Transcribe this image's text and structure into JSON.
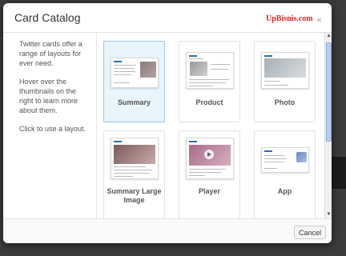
{
  "modal": {
    "title": "Card Catalog",
    "watermark": "UpBisnis.com",
    "close_glyph": "×"
  },
  "sidebar": {
    "paragraphs": [
      "Twitter cards offer a range of layouts for ever need.",
      "Hover over the thumbnails on the right to learn more about them.",
      "Click to use a layout."
    ]
  },
  "cards": [
    {
      "label": "Summary",
      "selected": true
    },
    {
      "label": "Product",
      "selected": false
    },
    {
      "label": "Photo",
      "selected": false
    },
    {
      "label": "Summary Large Image",
      "selected": false
    },
    {
      "label": "Player",
      "selected": false
    },
    {
      "label": "App",
      "selected": false
    }
  ],
  "footer": {
    "cancel_label": "Cancel"
  },
  "icons": {
    "close": "close-icon",
    "scroll_up": "scroll-up-icon",
    "scroll_down": "scroll-down-icon"
  },
  "colors": {
    "selected_bg": "#e9f4fb",
    "accent_blue": "#2b6fb3",
    "watermark": "#dd2222"
  }
}
